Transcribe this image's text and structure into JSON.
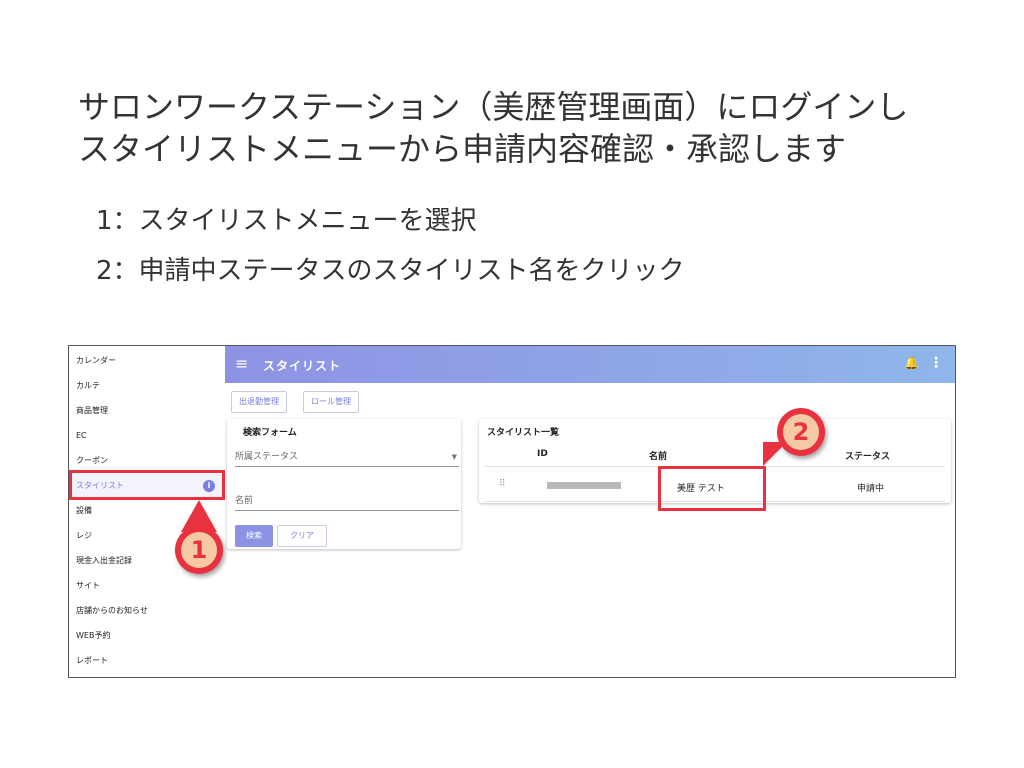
{
  "slide": {
    "heading": "サロンワークステーション（美歴管理画面）にログインし\nスタイリストメニューから申請内容確認・承認します",
    "steps": [
      "1：スタイリストメニューを選択",
      "2：申請中ステータスのスタイリスト名をクリック"
    ]
  },
  "sidebar": {
    "items": [
      {
        "label": "カレンダー"
      },
      {
        "label": "カルテ"
      },
      {
        "label": "商品管理"
      },
      {
        "label": "EC"
      },
      {
        "label": "クーポン"
      },
      {
        "label": "スタイリスト",
        "active": true
      },
      {
        "label": "設備"
      },
      {
        "label": "レジ"
      },
      {
        "label": "現金入出金記録"
      },
      {
        "label": "サイト"
      },
      {
        "label": "店舗からのお知らせ"
      },
      {
        "label": "WEB予約"
      },
      {
        "label": "レポート"
      }
    ],
    "info_glyph": "i"
  },
  "appbar": {
    "title": "スタイリスト",
    "menu_glyph": "≡",
    "bell_glyph": "🔔",
    "more_glyph": "⋮"
  },
  "toolbar": {
    "attendance_label": "出退勤管理",
    "role_label": "ロール管理"
  },
  "search_form": {
    "title": "検索フォーム",
    "status_placeholder": "所属ステータス",
    "caret_glyph": "▼",
    "name_placeholder": "名前",
    "search_label": "検索",
    "clear_label": "クリア"
  },
  "stylist_list": {
    "title": "スタイリスト一覧",
    "columns": [
      "ID",
      "名前",
      "ステータス"
    ],
    "rows": [
      {
        "name": "美歴 テスト",
        "status": "申請中"
      }
    ],
    "drag_glyph": "⠿"
  },
  "callouts": {
    "one": "1",
    "two": "2"
  },
  "colors": {
    "accent": "#8e92e4",
    "highlight": "#e8323f"
  }
}
